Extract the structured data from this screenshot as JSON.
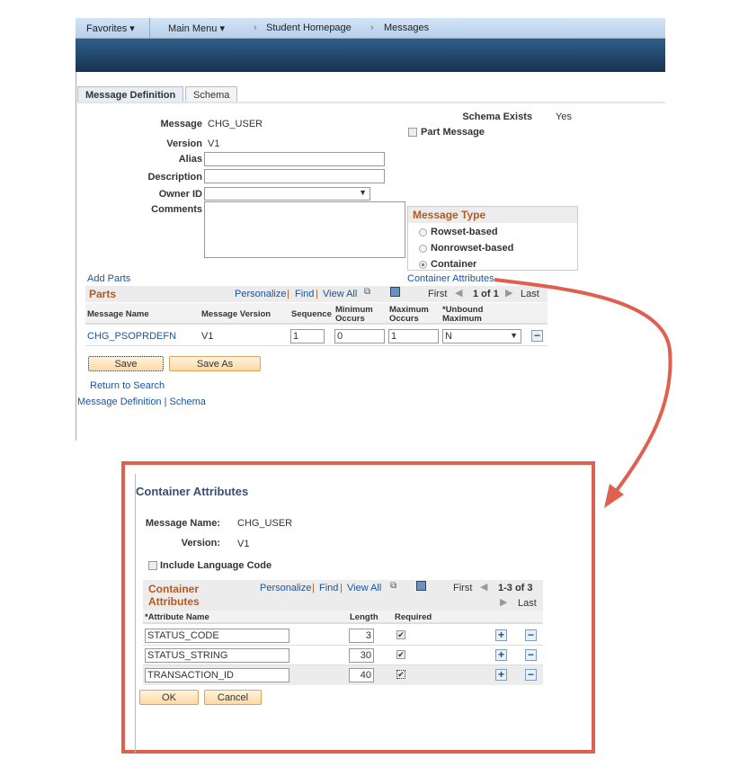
{
  "nav": {
    "favorites": "Favorites ▾",
    "main_menu": "Main Menu ▾",
    "sep1": "›",
    "crumb1": "Student Homepage",
    "sep2": "›",
    "crumb2": "Messages"
  },
  "tabs": [
    {
      "label": "Message Definition",
      "active": true
    },
    {
      "label": "Schema",
      "active": false
    }
  ],
  "form": {
    "message_label": "Message",
    "message": "CHG_USER",
    "version_label": "Version",
    "version": "V1",
    "alias_label": "Alias",
    "alias": "",
    "description_label": "Description",
    "description": "",
    "owner_label": "Owner ID",
    "owner": "",
    "comments_label": "Comments",
    "comments": "",
    "schema_exists_label": "Schema Exists",
    "schema_exists": "Yes",
    "part_message_label": "Part Message"
  },
  "message_type": {
    "title": "Message Type",
    "options": [
      "Rowset-based",
      "Nonrowset-based",
      "Container"
    ],
    "selected": "Container"
  },
  "add_parts": "Add Parts",
  "container_attributes_link": "Container Attributes",
  "parts": {
    "title": "Parts",
    "personalize": "Personalize",
    "find": "Find",
    "view_all": "View All",
    "first": "First",
    "range": "1 of 1",
    "last": "Last",
    "columns": [
      "Message Name",
      "Message Version",
      "Sequence",
      "Minimum Occurs",
      "Maximum Occurs",
      "*Unbound Maximum"
    ],
    "rows": [
      {
        "name": "CHG_PSOPRDEFN",
        "version": "V1",
        "sequence": "1",
        "min": "0",
        "max": "1",
        "unbound": "N"
      }
    ]
  },
  "buttons": {
    "save": "Save",
    "save_as": "Save As",
    "return": "Return to Search"
  },
  "footer_links": {
    "def": "Message Definition",
    "sep": "|",
    "schema": "Schema"
  },
  "popup": {
    "title": "Container Attributes",
    "msg_name_label": "Message Name:",
    "msg_name": "CHG_USER",
    "version_label": "Version:",
    "version": "V1",
    "include_lang": "Include Language Code",
    "grid_title": "Container Attributes",
    "personalize": "Personalize",
    "find": "Find",
    "view_all": "View All",
    "first": "First",
    "range": "1-3 of 3",
    "last": "Last",
    "columns": [
      "*Attribute Name",
      "Length",
      "Required"
    ],
    "rows": [
      {
        "name": "STATUS_CODE",
        "length": "3",
        "required": true
      },
      {
        "name": "STATUS_STRING",
        "length": "30",
        "required": true
      },
      {
        "name": "TRANSACTION_ID",
        "length": "40",
        "required": true
      }
    ],
    "ok": "OK",
    "cancel": "Cancel"
  },
  "colors": {
    "accent_orange": "#b45a1e",
    "link": "#1a55a0",
    "callout": "#e06050"
  }
}
